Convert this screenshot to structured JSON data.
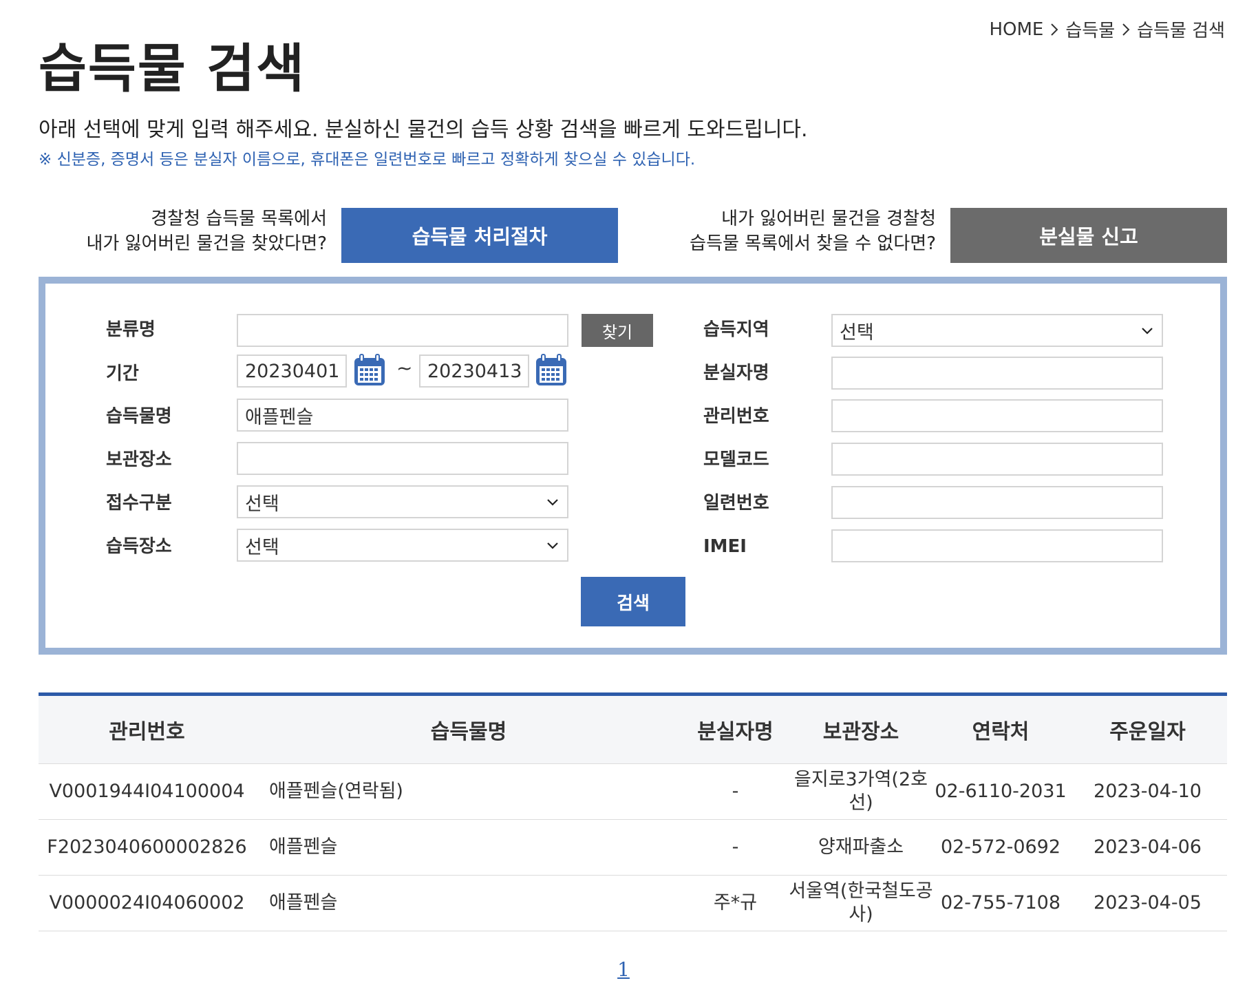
{
  "breadcrumb": [
    "HOME",
    "습득물",
    "습득물 검색"
  ],
  "page_title": "습득물 검색",
  "intro": "아래 선택에 맞게 입력 해주세요. 분실하신 물건의 습득 상황 검색을 빠르게 도와드립니다.",
  "notice": "※ 신분증, 증명서 등은 분실자 이름으로, 휴대폰은 일련번호로 빠르고 정확하게 찾으실 수 있습니다.",
  "actions": {
    "procedure_question_line1": "경찰청 습득물 목록에서",
    "procedure_question_line2": "내가 잃어버린 물건을 찾았다면?",
    "procedure_button": "습득물 처리절차",
    "report_question_line1": "내가 잃어버린 물건을 경찰청",
    "report_question_line2": "습득물 목록에서 찾을 수 없다면?",
    "report_button": "분실물 신고"
  },
  "form": {
    "category_label": "분류명",
    "category_value": "",
    "find_button": "찾기",
    "period_label": "기간",
    "period_start": "20230401",
    "period_separator": "~",
    "period_end": "20230413",
    "item_name_label": "습득물명",
    "item_name_value": "애플펜슬",
    "storage_label": "보관장소",
    "storage_value": "",
    "intake_type_label": "접수구분",
    "intake_type_value": "선택",
    "found_place_label": "습득장소",
    "found_place_value": "선택",
    "region_label": "습득지역",
    "region_value": "선택",
    "owner_name_label": "분실자명",
    "owner_name_value": "",
    "manage_no_label": "관리번호",
    "manage_no_value": "",
    "model_code_label": "모델코드",
    "model_code_value": "",
    "serial_label": "일련번호",
    "serial_value": "",
    "imei_label": "IMEI",
    "imei_value": "",
    "search_button": "검색"
  },
  "table": {
    "columns": [
      "관리번호",
      "습득물명",
      "분실자명",
      "보관장소",
      "연락처",
      "주운일자"
    ],
    "rows": [
      [
        "V0001944I04100004",
        "애플펜슬(연락됨)",
        "-",
        "을지로3가역(2호선)",
        "02-6110-2031",
        "2023-04-10"
      ],
      [
        "F2023040600002826",
        "애플펜슬",
        "-",
        "양재파출소",
        "02-572-0692",
        "2023-04-06"
      ],
      [
        "V0000024I04060002",
        "애플펜슬",
        "주*규",
        "서울역(한국철도공사)",
        "02-755-7108",
        "2023-04-05"
      ]
    ]
  },
  "pagination": {
    "current": "1"
  },
  "colors": {
    "accent_blue": "#3a6ab5",
    "gray_button": "#6b6b6b",
    "box_border": "#9bb3d6",
    "notice_blue": "#2e62b2"
  },
  "icons": [
    "chevron-right-icon",
    "calendar-icon",
    "chevron-down-icon"
  ]
}
